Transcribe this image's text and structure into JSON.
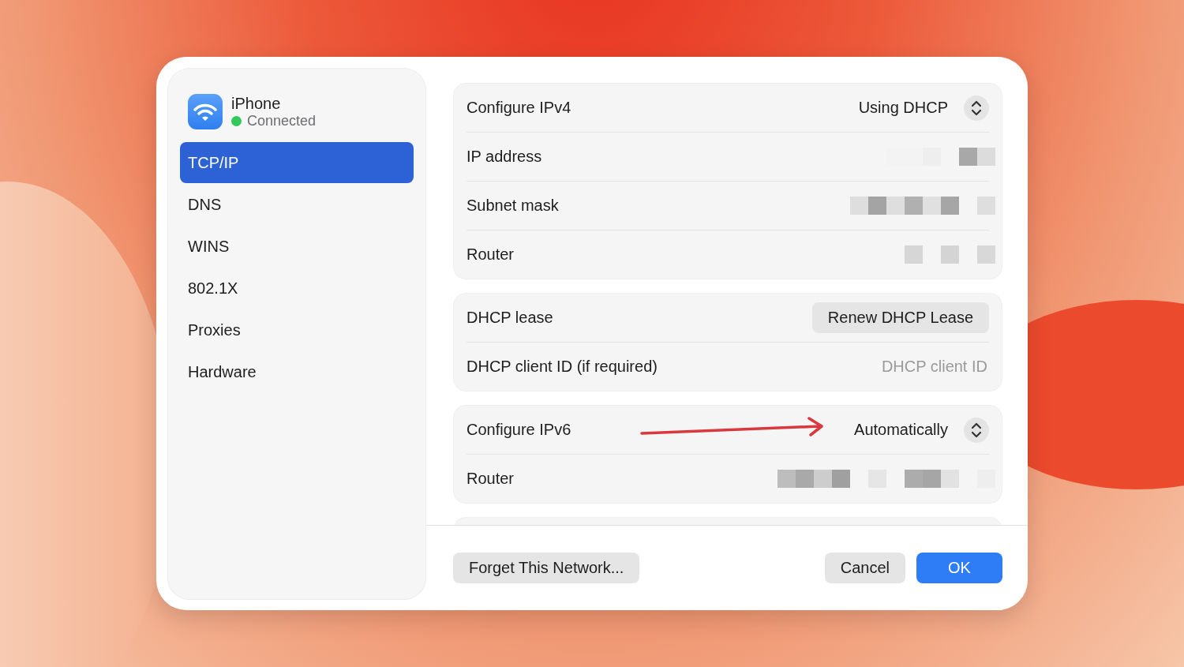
{
  "network": {
    "name": "iPhone",
    "status": "Connected",
    "color": "#34c759"
  },
  "sidebar": {
    "items": [
      {
        "label": "TCP/IP",
        "selected": true
      },
      {
        "label": "DNS",
        "selected": false
      },
      {
        "label": "WINS",
        "selected": false
      },
      {
        "label": "802.1X",
        "selected": false
      },
      {
        "label": "Proxies",
        "selected": false
      },
      {
        "label": "Hardware",
        "selected": false
      }
    ]
  },
  "groups": [
    {
      "rows": [
        {
          "kind": "popup",
          "label": "Configure IPv4",
          "value": "Using DHCP"
        },
        {
          "kind": "redacted",
          "label": "IP address"
        },
        {
          "kind": "redacted",
          "label": "Subnet mask"
        },
        {
          "kind": "redacted",
          "label": "Router"
        }
      ]
    },
    {
      "rows": [
        {
          "kind": "button",
          "label": "DHCP lease",
          "button": "Renew DHCP Lease"
        },
        {
          "kind": "field",
          "label": "DHCP client ID (if required)",
          "placeholder": "DHCP client ID"
        }
      ]
    },
    {
      "rows": [
        {
          "kind": "popup",
          "label": "Configure IPv6",
          "value": "Automatically",
          "annotated": true
        },
        {
          "kind": "redacted",
          "label": "Router"
        }
      ]
    }
  ],
  "footer": {
    "forget_button": "Forget This Network...",
    "cancel_button": "Cancel",
    "ok_button": "OK"
  }
}
